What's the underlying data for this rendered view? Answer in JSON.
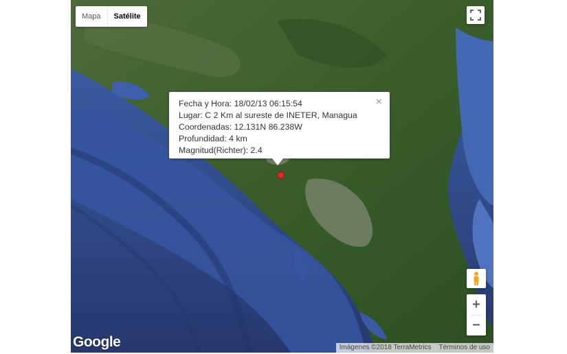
{
  "map_type_control": {
    "map_label": "Mapa",
    "satellite_label": "Satélite",
    "selected": "Satélite"
  },
  "info_window": {
    "fecha": "Fecha y Hora: 18/02/13 06:15:54",
    "lugar": "Lugar: C 2 Km al sureste de INETER, Managua",
    "coordenadas": "Coordenadas: 12.131N 86.238W",
    "profundidad": "Profundidad: 4 km",
    "magnitud": "Magnitud(Richter): 2.4",
    "close_glyph": "×"
  },
  "zoom": {
    "in_label": "+",
    "out_label": "−"
  },
  "logo": "Google",
  "attribution": {
    "imagery": "Imágenes ©2018 TerraMetrics",
    "terms": "Términos de uso"
  },
  "colors": {
    "ocean_deep": "#2a3f7a",
    "ocean_shallow": "#3d5fa8",
    "land": "#3c5c2c",
    "lake": "#6f7d62",
    "marker": "#d0302a"
  },
  "icons": {
    "fullscreen": "fullscreen-icon",
    "pegman": "pegman-icon",
    "marker": "map-marker-icon",
    "close": "close-icon"
  }
}
